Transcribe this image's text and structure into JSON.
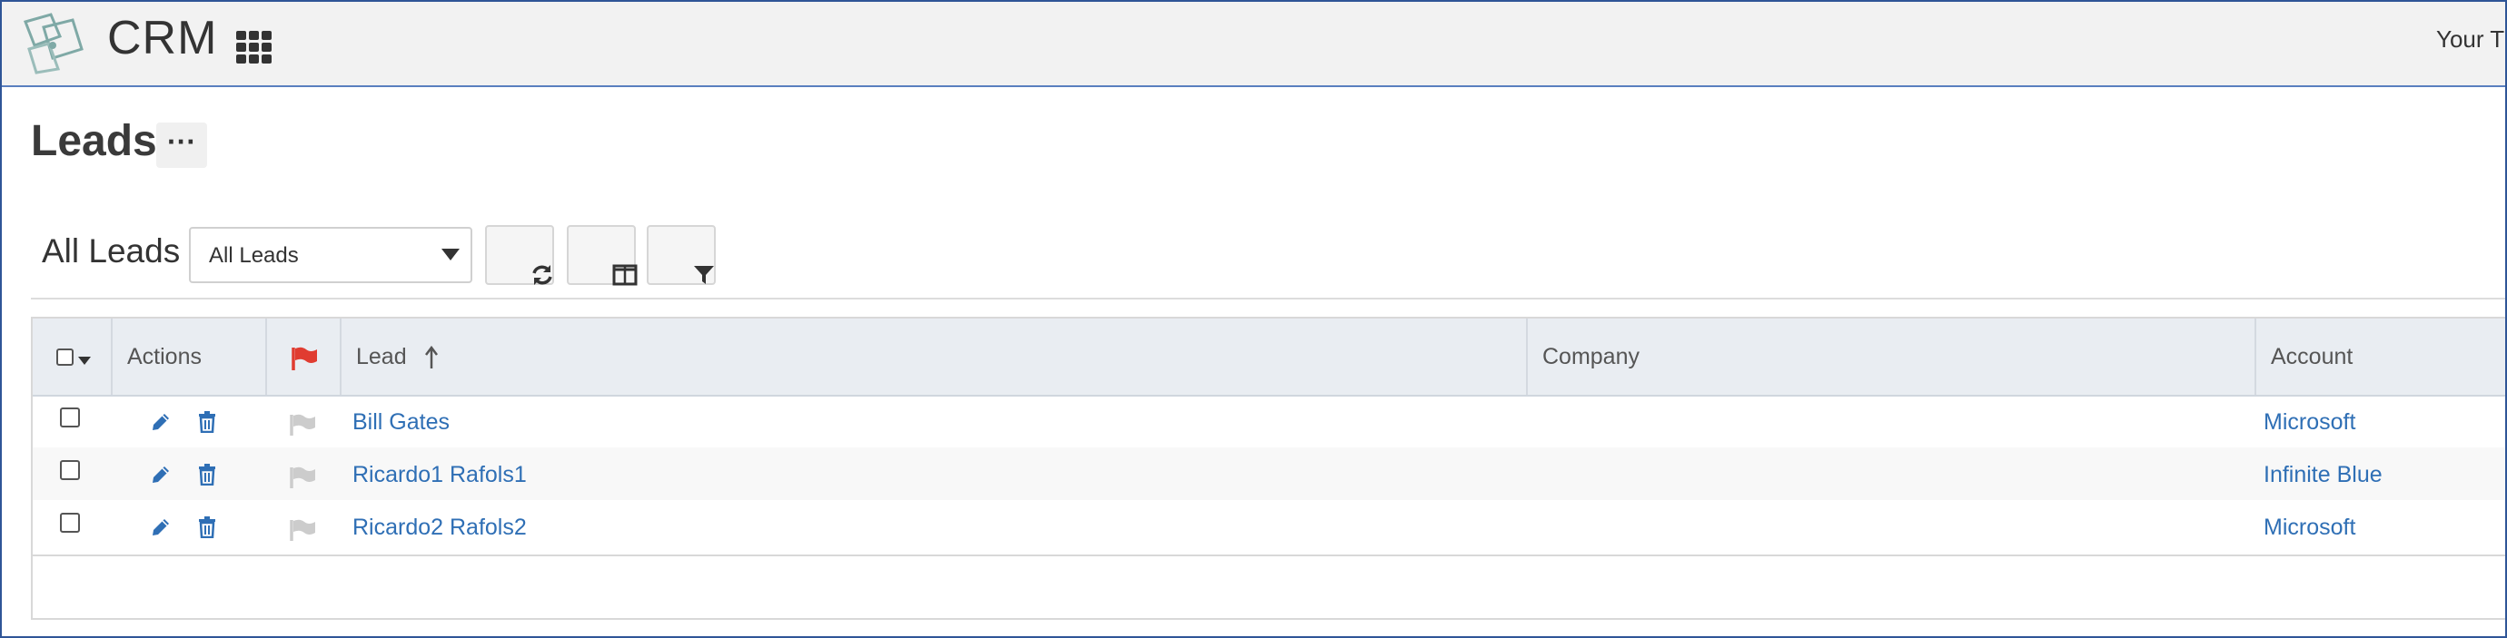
{
  "header": {
    "app_title": "CRM",
    "user_label": "Your Tr",
    "accent_color": "#2f5597",
    "icons": {
      "logo": "crm-logo-icon",
      "apps": "app-grid-icon"
    }
  },
  "page": {
    "title": "Leads",
    "more_label": "···"
  },
  "list_view": {
    "title": "All Leads",
    "view_select_value": "All Leads",
    "tools": [
      "refresh-icon",
      "columns-icon",
      "filter-icon"
    ]
  },
  "table": {
    "columns": [
      "Actions",
      "Lead",
      "Company",
      "Account"
    ],
    "sort_column": "Lead",
    "sort_direction": "ascending",
    "flag_active_color": "#e03c31",
    "flag_inactive_color": "#cccccc",
    "link_color": "#2f6fb5",
    "rows": [
      {
        "lead": "Bill Gates",
        "company": "",
        "account": "Microsoft"
      },
      {
        "lead": "Ricardo1 Rafols1",
        "company": "",
        "account": "Infinite Blue"
      },
      {
        "lead": "Ricardo2 Rafols2",
        "company": "",
        "account": "Microsoft"
      }
    ]
  }
}
